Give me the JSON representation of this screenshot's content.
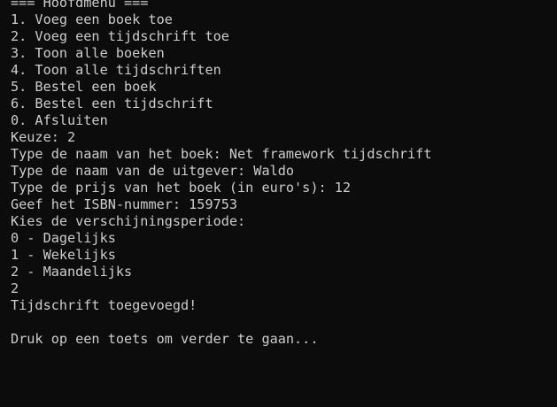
{
  "console": {
    "lines": [
      "=== Hoofdmenu ===",
      "1. Voeg een boek toe",
      "2. Voeg een tijdschrift toe",
      "3. Toon alle boeken",
      "4. Toon alle tijdschriften",
      "5. Bestel een boek",
      "6. Bestel een tijdschrift",
      "0. Afsluiten",
      "Keuze: 2",
      "Type de naam van het boek: Net framework tijdschrift",
      "Type de naam van de uitgever: Waldo",
      "Type de prijs van het boek (in euro's): 12",
      "Geef het ISBN-nummer: 159753",
      "Kies de verschijningsperiode:",
      "0 - Dagelijks",
      "1 - Wekelijks",
      "2 - Maandelijks",
      "2",
      "Tijdschrift toegevoegd!",
      "",
      "Druk op een toets om verder te gaan..."
    ],
    "colors": {
      "background": "#0c0c0c",
      "foreground": "#cccccc"
    }
  }
}
